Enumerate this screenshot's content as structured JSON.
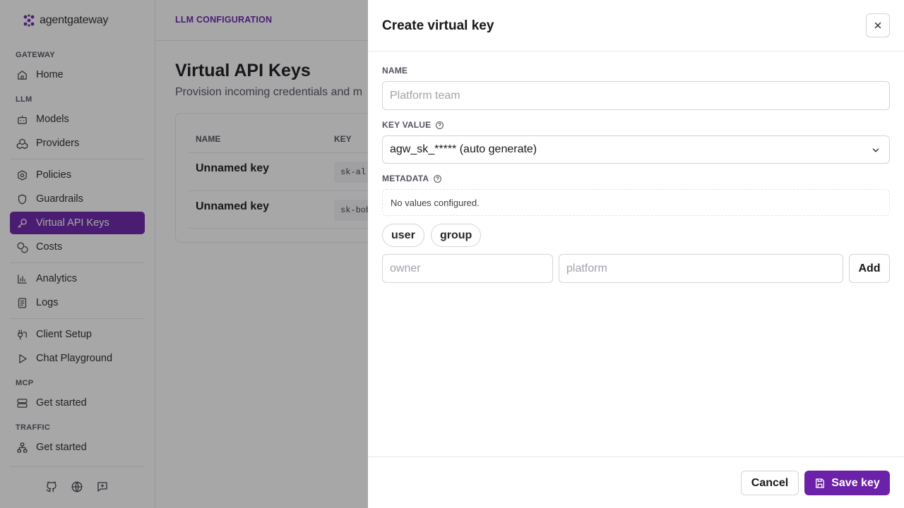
{
  "brand": {
    "name": "agentgateway"
  },
  "sidebar": {
    "sections": {
      "gateway": "GATEWAY",
      "llm": "LLM",
      "mcp": "MCP",
      "traffic": "TRAFFIC"
    },
    "items": {
      "home": "Home",
      "models": "Models",
      "providers": "Providers",
      "policies": "Policies",
      "guardrails": "Guardrails",
      "virtual_keys": "Virtual API Keys",
      "costs": "Costs",
      "analytics": "Analytics",
      "logs": "Logs",
      "client_setup": "Client Setup",
      "chat_playground": "Chat Playground",
      "mcp_get_started": "Get started",
      "traffic_get_started": "Get started"
    },
    "active": "virtual_keys"
  },
  "header": {
    "breadcrumb": "LLM CONFIGURATION"
  },
  "main": {
    "title": "Virtual API Keys",
    "subtitle": "Provision incoming credentials and m",
    "table": {
      "columns": [
        "NAME",
        "KEY"
      ],
      "rows": [
        {
          "name": "Unnamed key",
          "key": "sk-al"
        },
        {
          "name": "Unnamed key",
          "key": "sk-bob"
        }
      ]
    }
  },
  "drawer": {
    "title": "Create virtual key",
    "name_label": "NAME",
    "name_placeholder": "Platform team",
    "key_value_label": "KEY VALUE",
    "key_value_selected": "agw_sk_***** (auto generate)",
    "metadata_label": "METADATA",
    "metadata_empty": "No values configured.",
    "suggestions": [
      "user",
      "group"
    ],
    "metadata_key_placeholder": "owner",
    "metadata_value_placeholder": "platform",
    "add_label": "Add",
    "cancel_label": "Cancel",
    "save_label": "Save key"
  },
  "colors": {
    "accent": "#6b21a8",
    "overlay": "rgba(24,24,27,0.38)"
  }
}
